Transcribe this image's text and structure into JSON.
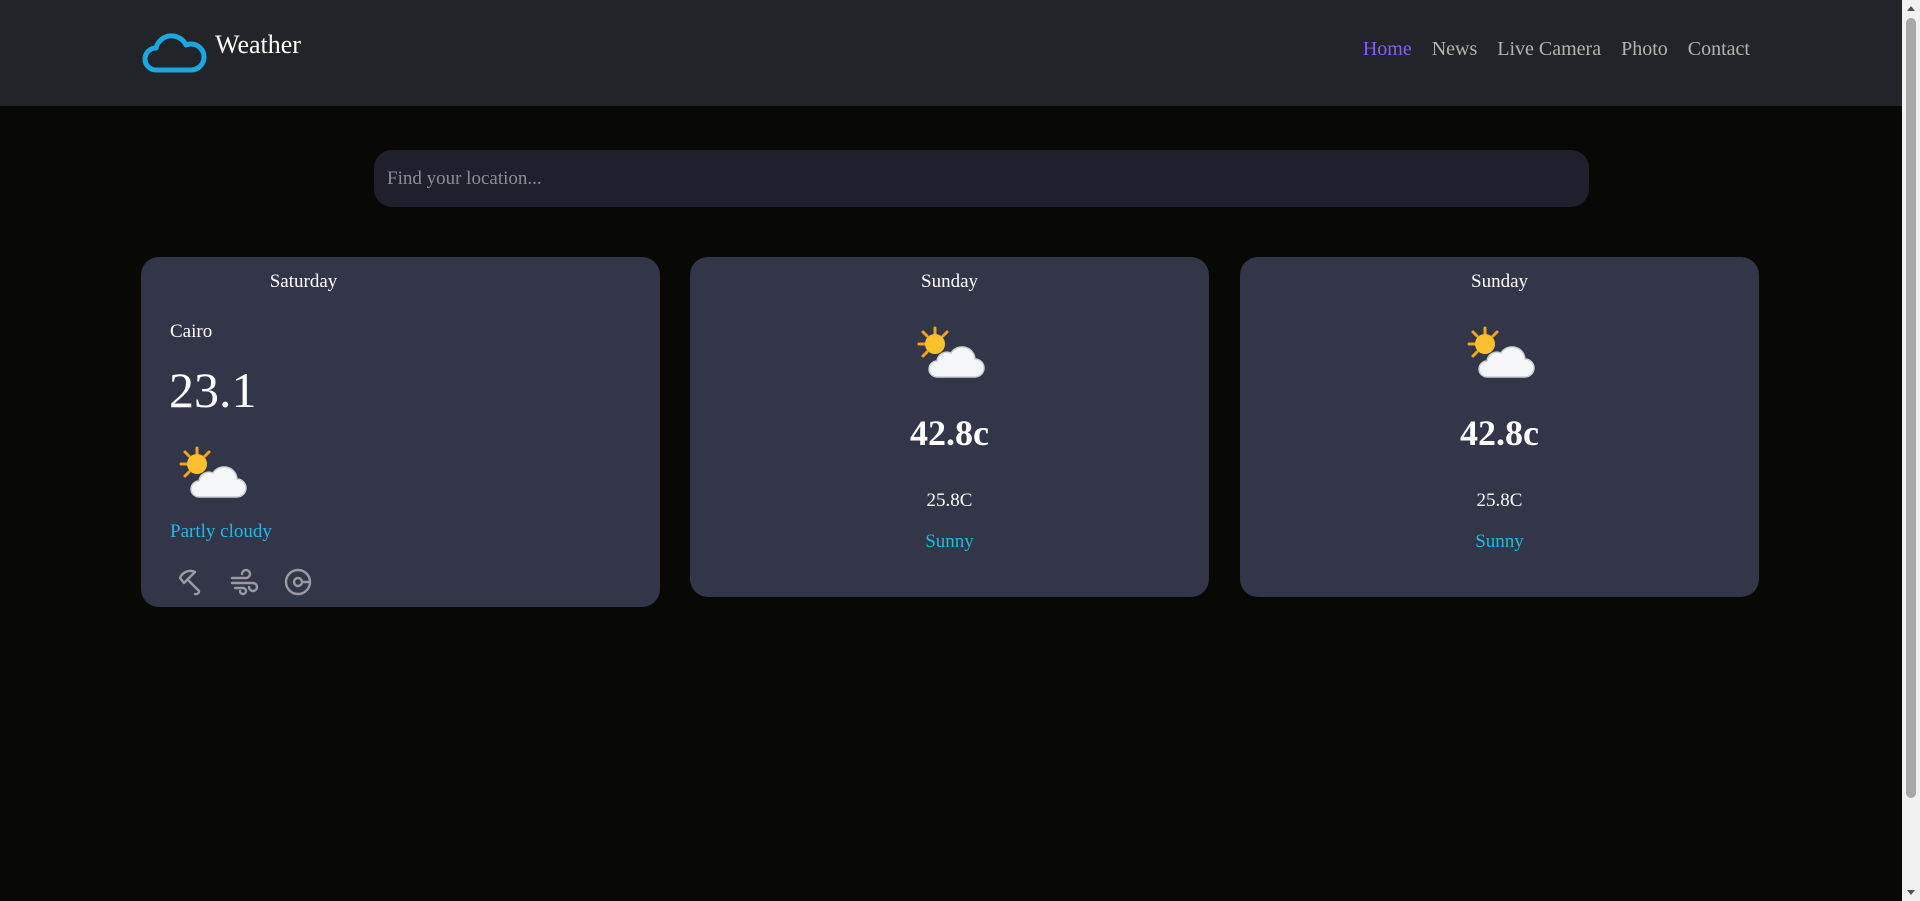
{
  "brand": {
    "name": "Weather",
    "logo_icon": "cloud-icon",
    "logo_color": "#1ba8e0"
  },
  "nav": {
    "items": [
      {
        "label": "Home",
        "active": true
      },
      {
        "label": "News",
        "active": false
      },
      {
        "label": "Live Camera",
        "active": false
      },
      {
        "label": "Photo",
        "active": false
      },
      {
        "label": "Contact",
        "active": false
      }
    ],
    "active_color": "#8a5cf5"
  },
  "search": {
    "placeholder": "Find your location...",
    "value": ""
  },
  "today": {
    "day": "Saturday",
    "city": "Cairo",
    "temp": "23.1",
    "condition_icon": "sun-behind-cloud-icon",
    "condition": "Partly cloudy",
    "stat_icons": [
      "umbrella-icon",
      "wind-icon",
      "compass-icon"
    ]
  },
  "forecast": [
    {
      "day": "Sunday",
      "condition_icon": "sun-behind-cloud-icon",
      "max": "42.8c",
      "min": "25.8C",
      "condition": "Sunny"
    },
    {
      "day": "Sunday",
      "condition_icon": "sun-behind-cloud-icon",
      "max": "42.8c",
      "min": "25.8C",
      "condition": "Sunny"
    }
  ],
  "colors": {
    "navbar_bg": "#212429",
    "page_bg": "#080804",
    "card_bg": "#323648",
    "search_bg": "#1e202e",
    "condition_text": "#22b8e8"
  }
}
